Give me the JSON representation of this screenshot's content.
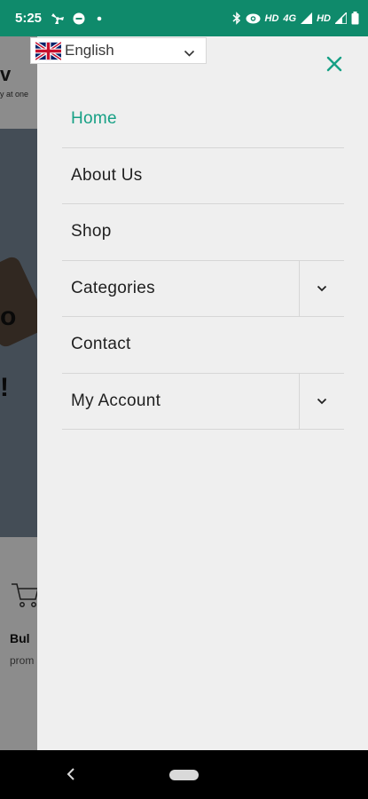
{
  "status_bar": {
    "time": "5:25",
    "hd1": "HD",
    "net": "4G",
    "hd2": "HD",
    "bg_color": "#0f8a6b",
    "icons": [
      "fan-icon",
      "chat-icon",
      "dot-icon",
      "bluetooth-icon",
      "eye-icon",
      "signal-icon",
      "signal-icon",
      "battery-icon"
    ]
  },
  "background_page": {
    "header_fragment": "v",
    "tagline_fragment": "y at one",
    "hero_glyph1": "o",
    "hero_glyph2": "!",
    "feature_title": "Bul",
    "feature_subtitle": "prom"
  },
  "language_selector": {
    "label": "English",
    "flag": "uk-flag-icon"
  },
  "drawer": {
    "accent_color": "#16a085",
    "menu_items": [
      {
        "label": "Home",
        "active": true,
        "has_submenu": false
      },
      {
        "label": "About Us",
        "active": false,
        "has_submenu": false
      },
      {
        "label": "Shop",
        "active": false,
        "has_submenu": false
      },
      {
        "label": "Categories",
        "active": false,
        "has_submenu": true
      },
      {
        "label": "Contact",
        "active": false,
        "has_submenu": false
      },
      {
        "label": "My Account",
        "active": false,
        "has_submenu": true
      }
    ]
  },
  "nav_bar": {
    "back_icon": "back-icon",
    "home_icon": "home-pill-icon"
  }
}
